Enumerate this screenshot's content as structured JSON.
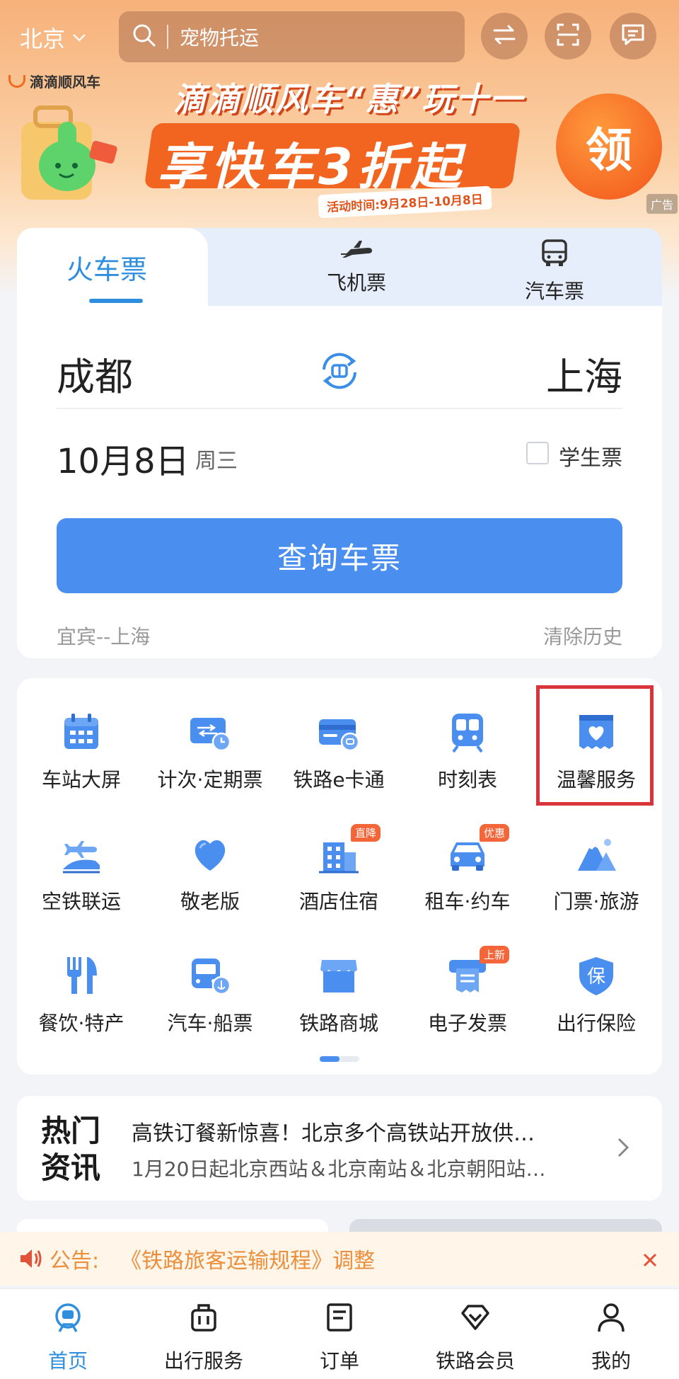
{
  "header": {
    "city": "北京",
    "search_placeholder": "宠物托运",
    "buttons": [
      "swap-icon",
      "scan-icon",
      "message-icon"
    ]
  },
  "banner": {
    "brand": "滴滴顺风车",
    "title": "滴滴顺风车“惠”玩十一",
    "headline": "享快车3折起",
    "date_range": "活动时间:9月28日-10月8日",
    "claim_label": "领",
    "ad_tag": "广告"
  },
  "ticket": {
    "tabs": [
      {
        "label": "火车票",
        "icon": "train-icon",
        "active": true
      },
      {
        "label": "飞机票",
        "icon": "plane-icon",
        "active": false
      },
      {
        "label": "汽车票",
        "icon": "bus-icon",
        "active": false
      }
    ],
    "from_city": "成都",
    "to_city": "上海",
    "date": "10月8日",
    "weekday": "周三",
    "student_label": "学生票",
    "student_checked": false,
    "query_button": "查询车票",
    "history": "宜宾--上海",
    "clear_history": "清除历史"
  },
  "services": {
    "items": [
      {
        "label": "车站大屏",
        "icon": "calendar-icon"
      },
      {
        "label": "计次·定期票",
        "icon": "ticket-clock-icon"
      },
      {
        "label": "铁路e卡通",
        "icon": "card-icon"
      },
      {
        "label": "时刻表",
        "icon": "train-front-icon"
      },
      {
        "label": "温馨服务",
        "icon": "heart-ticket-icon",
        "highlighted": true
      },
      {
        "label": "空铁联运",
        "icon": "plane-train-icon"
      },
      {
        "label": "敬老版",
        "icon": "heart-icon"
      },
      {
        "label": "酒店住宿",
        "icon": "hotel-icon",
        "badge": "直降"
      },
      {
        "label": "租车·约车",
        "icon": "car-icon",
        "badge": "优惠"
      },
      {
        "label": "门票·旅游",
        "icon": "mountain-icon"
      },
      {
        "label": "餐饮·特产",
        "icon": "fork-knife-icon"
      },
      {
        "label": "汽车·船票",
        "icon": "bus-anchor-icon"
      },
      {
        "label": "铁路商城",
        "icon": "shop-icon"
      },
      {
        "label": "电子发票",
        "icon": "invoice-icon",
        "badge": "上新"
      },
      {
        "label": "出行保险",
        "icon": "shield-icon",
        "icon_text": "保"
      }
    ]
  },
  "news": {
    "tag_line1": "热门",
    "tag_line2": "资讯",
    "line1": "高铁订餐新惊喜！北京多个高铁站开放供…",
    "line2": "1月20日起北京西站＆北京南站＆北京朝阳站…"
  },
  "notice": {
    "label": "公告:",
    "text": "《铁路旅客运输规程》调整"
  },
  "bottom_nav": [
    {
      "label": "首页",
      "icon": "home-icon",
      "active": true
    },
    {
      "label": "出行服务",
      "icon": "luggage-icon",
      "active": false
    },
    {
      "label": "订单",
      "icon": "order-icon",
      "active": false
    },
    {
      "label": "铁路会员",
      "icon": "diamond-icon",
      "active": false
    },
    {
      "label": "我的",
      "icon": "user-icon",
      "active": false
    }
  ],
  "colors": {
    "primary": "#4a8ff0",
    "accent_blue": "#2f8fde",
    "highlight_red": "#d9343a",
    "notice_orange": "#ec8f3d",
    "banner_orange": "#f26521"
  }
}
